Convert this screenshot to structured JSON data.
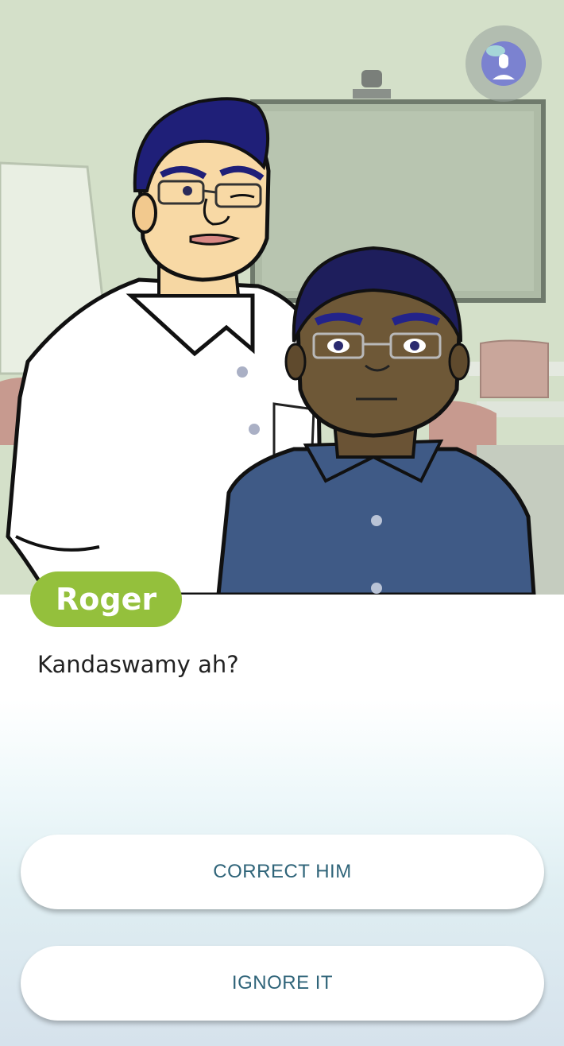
{
  "scene": {
    "speaker_name": "Roger",
    "dialogue": "Kandaswamy ah?"
  },
  "choices": [
    {
      "label": "CORRECT HIM"
    },
    {
      "label": "IGNORE IT"
    }
  ],
  "profile": {
    "icon": "user-avatar-icon"
  },
  "colors": {
    "speaker_badge": "#94c03c",
    "choice_text": "#2f6479",
    "avatar_bg": "#7b82d0"
  }
}
